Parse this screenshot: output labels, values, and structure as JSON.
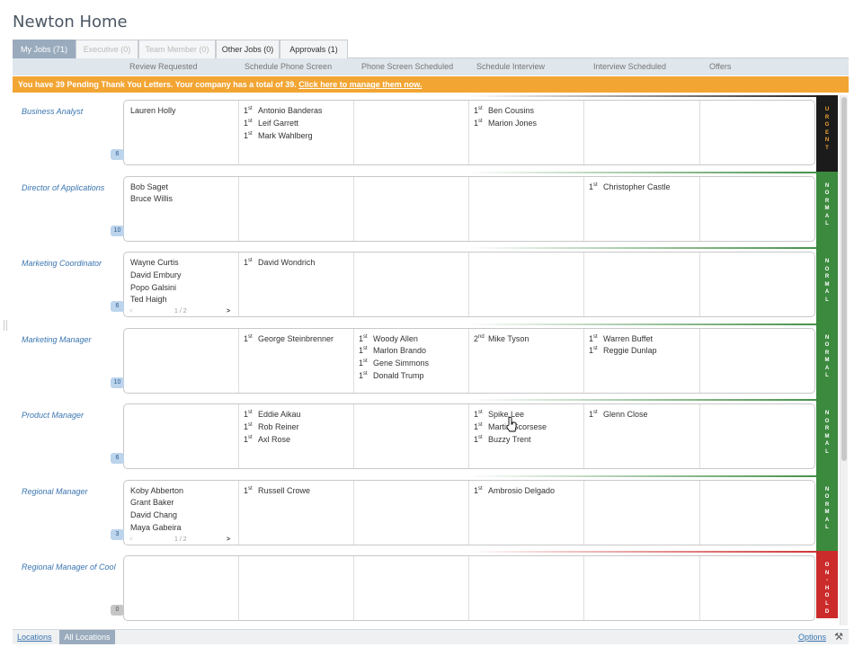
{
  "page": {
    "title": "Newton Home"
  },
  "tabs": [
    {
      "label": "My Jobs (71)"
    },
    {
      "label": "Executive (0)"
    },
    {
      "label": "Team Member (0)"
    },
    {
      "label": "Other Jobs (0)"
    },
    {
      "label": "Approvals (1)"
    }
  ],
  "stages": [
    "Review Requested",
    "Schedule Phone Screen",
    "Phone Screen Scheduled",
    "Schedule Interview",
    "Interview Scheduled",
    "Offers"
  ],
  "banner": {
    "text": "You have 39 Pending Thank You Letters. Your company has a total of 39.",
    "link": "Click here to manage them now."
  },
  "colors": {
    "urgent": "#1b1b1b",
    "normal": "#3b8a3e",
    "on_hold": "#cc2b2b",
    "tab_active": "#9aabbd",
    "banner": "#f2a533",
    "link": "#3a75b0"
  },
  "rows": [
    {
      "title": "Business Analyst",
      "count": "6",
      "status": "URGENT",
      "status_color": "#1b1b1b",
      "status_text_color": "#f2a533",
      "cols": [
        [
          {
            "rank": "",
            "name": "Lauren Holly"
          }
        ],
        [
          {
            "rank": "1st",
            "name": "Antonio Banderas"
          },
          {
            "rank": "1st",
            "name": "Leif Garrett"
          },
          {
            "rank": "1st",
            "name": "Mark Wahlberg"
          }
        ],
        [],
        [
          {
            "rank": "1st",
            "name": "Ben Cousins"
          },
          {
            "rank": "1st",
            "name": "Marion Jones"
          }
        ],
        [],
        []
      ],
      "pager": ""
    },
    {
      "title": "Director of Applications",
      "count": "10",
      "status": "NORMAL",
      "status_color": "#3b8a3e",
      "status_text_color": "#ffffff",
      "cols": [
        [
          {
            "rank": "",
            "name": "Bob Saget"
          },
          {
            "rank": "",
            "name": "Bruce Willis"
          }
        ],
        [],
        [],
        [],
        [
          {
            "rank": "1st",
            "name": "Christopher Castle"
          }
        ],
        []
      ],
      "pager": ""
    },
    {
      "title": "Marketing Coordinator",
      "count": "6",
      "status": "NORMAL",
      "status_color": "#3b8a3e",
      "status_text_color": "#ffffff",
      "cols": [
        [
          {
            "rank": "",
            "name": "Wayne Curtis"
          },
          {
            "rank": "",
            "name": "David Embury"
          },
          {
            "rank": "",
            "name": "Popo Galsini"
          },
          {
            "rank": "",
            "name": "Ted Haigh"
          }
        ],
        [
          {
            "rank": "1st",
            "name": "David Wondrich"
          }
        ],
        [],
        [],
        [],
        []
      ],
      "pager": "1 / 2"
    },
    {
      "title": "Marketing Manager",
      "count": "10",
      "status": "NORMAL",
      "status_color": "#3b8a3e",
      "status_text_color": "#ffffff",
      "cols": [
        [],
        [
          {
            "rank": "1st",
            "name": "George Steinbrenner"
          }
        ],
        [
          {
            "rank": "1st",
            "name": "Woody Allen"
          },
          {
            "rank": "1st",
            "name": "Marlon Brando"
          },
          {
            "rank": "1st",
            "name": "Gene Simmons"
          },
          {
            "rank": "1st",
            "name": "Donald Trump"
          }
        ],
        [
          {
            "rank": "2nd",
            "name": "Mike Tyson"
          }
        ],
        [
          {
            "rank": "1st",
            "name": "Warren Buffet"
          },
          {
            "rank": "1st",
            "name": "Reggie Dunlap"
          }
        ],
        []
      ],
      "pager": ""
    },
    {
      "title": "Product Manager",
      "count": "6",
      "status": "NORMAL",
      "status_color": "#3b8a3e",
      "status_text_color": "#ffffff",
      "cols": [
        [],
        [
          {
            "rank": "1st",
            "name": "Eddie Aikau"
          },
          {
            "rank": "1st",
            "name": "Rob Reiner"
          },
          {
            "rank": "1st",
            "name": "Axl Rose"
          }
        ],
        [],
        [
          {
            "rank": "1st",
            "name": "Spike Lee"
          },
          {
            "rank": "1st",
            "name": "Martin Scorsese"
          },
          {
            "rank": "1st",
            "name": "Buzzy Trent"
          }
        ],
        [
          {
            "rank": "1st",
            "name": "Glenn Close"
          }
        ],
        []
      ],
      "pager": ""
    },
    {
      "title": "Regional Manager",
      "count": "3",
      "status": "NORMAL",
      "status_color": "#3b8a3e",
      "status_text_color": "#ffffff",
      "cols": [
        [
          {
            "rank": "",
            "name": "Koby Abberton"
          },
          {
            "rank": "",
            "name": "Grant Baker"
          },
          {
            "rank": "",
            "name": "David Chang"
          },
          {
            "rank": "",
            "name": "Maya Gabeira"
          }
        ],
        [
          {
            "rank": "1st",
            "name": "Russell Crowe"
          }
        ],
        [],
        [
          {
            "rank": "1st",
            "name": "Ambrosio Delgado"
          }
        ],
        [],
        []
      ],
      "pager": "1 / 2"
    },
    {
      "title": "Regional Manager of Cool",
      "count": "0",
      "status": "ON-HOLD",
      "status_color": "#cc2b2b",
      "status_text_color": "#ffffff",
      "cols": [
        [],
        [],
        [],
        [],
        [],
        []
      ],
      "pager": ""
    }
  ],
  "footer": {
    "locations": "Locations",
    "all_locations": "All Locations",
    "options": "Options"
  }
}
